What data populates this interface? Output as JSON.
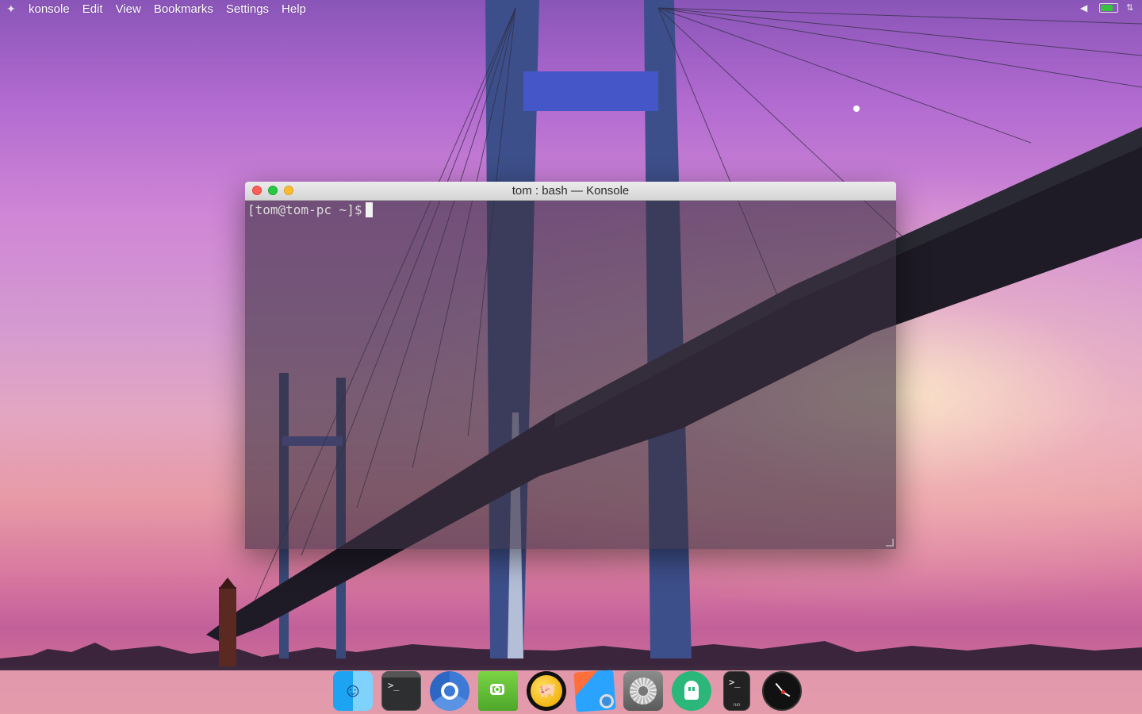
{
  "menubar": {
    "app_name": "konsole",
    "items": [
      "Edit",
      "View",
      "Bookmarks",
      "Settings",
      "Help"
    ],
    "tray": [
      "volume-icon",
      "battery-icon",
      "network-icon"
    ]
  },
  "window": {
    "title": "tom : bash — Konsole",
    "prompt": "[tom@tom-pc ~]$"
  },
  "dock": {
    "run_label": "run",
    "items": [
      "finder",
      "terminal",
      "chromium",
      "screenshot",
      "piggy-bank",
      "preview",
      "system-settings",
      "ghost",
      "run",
      "clock"
    ]
  },
  "colors": {
    "close": "#fc5f57",
    "minimize": "#fdbc2e",
    "maximize": "#29c840",
    "sky": "#c37fd4"
  }
}
